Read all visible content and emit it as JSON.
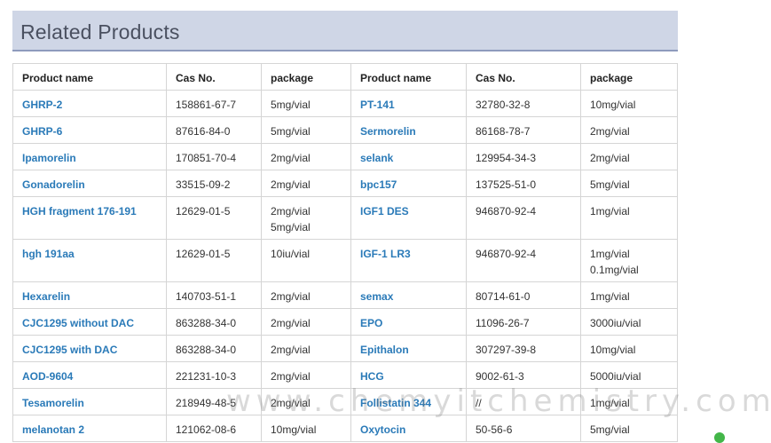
{
  "header": {
    "title": "Related Products"
  },
  "table": {
    "headers": [
      "Product name",
      "Cas No.",
      "package",
      "Product name",
      "Cas No.",
      "package"
    ],
    "rows": [
      {
        "left": {
          "name": "GHRP-2",
          "cas": "158861-67-7",
          "package": [
            "5mg/vial"
          ]
        },
        "right": {
          "name": "PT-141",
          "cas": "32780-32-8",
          "package": [
            "10mg/vial"
          ]
        }
      },
      {
        "left": {
          "name": "GHRP-6",
          "cas": "87616-84-0",
          "package": [
            "5mg/vial"
          ]
        },
        "right": {
          "name": "Sermorelin",
          "cas": "86168-78-7",
          "package": [
            "2mg/vial"
          ]
        }
      },
      {
        "left": {
          "name": "Ipamorelin",
          "cas": "170851-70-4",
          "package": [
            "2mg/vial"
          ]
        },
        "right": {
          "name": "selank",
          "cas": "129954-34-3",
          "package": [
            "2mg/vial"
          ]
        }
      },
      {
        "left": {
          "name": "Gonadorelin",
          "cas": "33515-09-2",
          "package": [
            "2mg/vial"
          ]
        },
        "right": {
          "name": "bpc157",
          "cas": "137525-51-0",
          "package": [
            "5mg/vial"
          ]
        }
      },
      {
        "left": {
          "name": "HGH fragment 176-191",
          "cas": "12629-01-5",
          "package": [
            "2mg/vial",
            "5mg/vial"
          ]
        },
        "right": {
          "name": "IGF1 DES",
          "cas": "946870-92-4",
          "package": [
            "1mg/vial"
          ]
        }
      },
      {
        "left": {
          "name": "hgh 191aa",
          "cas": "12629-01-5",
          "package": [
            "10iu/vial"
          ]
        },
        "right": {
          "name": "IGF-1 LR3",
          "cas": "946870-92-4",
          "package": [
            "1mg/vial",
            "0.1mg/vial"
          ]
        }
      },
      {
        "left": {
          "name": "Hexarelin",
          "cas": "140703-51-1",
          "package": [
            "2mg/vial"
          ]
        },
        "right": {
          "name": "semax",
          "cas": "80714-61-0",
          "package": [
            "1mg/vial"
          ]
        }
      },
      {
        "left": {
          "name": "CJC1295 without DAC",
          "cas": "863288-34-0",
          "package": [
            "2mg/vial"
          ]
        },
        "right": {
          "name": "EPO",
          "cas": "11096-26-7",
          "package": [
            "3000iu/vial"
          ]
        }
      },
      {
        "left": {
          "name": "CJC1295 with DAC",
          "cas": "863288-34-0",
          "package": [
            "2mg/vial"
          ]
        },
        "right": {
          "name": "Epithalon",
          "cas": "307297-39-8",
          "package": [
            "10mg/vial"
          ]
        }
      },
      {
        "left": {
          "name": "AOD-9604",
          "cas": "221231-10-3",
          "package": [
            "2mg/vial"
          ]
        },
        "right": {
          "name": "HCG",
          "cas": "9002-61-3",
          "package": [
            "5000iu/vial"
          ]
        }
      },
      {
        "left": {
          "name": "Tesamorelin",
          "cas": "218949-48-5",
          "package": [
            "2mg/vial"
          ]
        },
        "right": {
          "name": "Follistatin 344",
          "cas": "//",
          "package": [
            "1mg/vial"
          ]
        }
      },
      {
        "left": {
          "name": "melanotan 2",
          "cas": "121062-08-6",
          "package": [
            "10mg/vial"
          ]
        },
        "right": {
          "name": "Oxytocin",
          "cas": "50-56-6",
          "package": [
            "5mg/vial"
          ]
        }
      }
    ]
  },
  "watermark": "www.chemyitchemistry.com",
  "colors": {
    "header_bg": "#cfd6e6",
    "header_border": "#8e9bbd",
    "link": "#2a7ab8",
    "status_dot": "#43b649"
  }
}
